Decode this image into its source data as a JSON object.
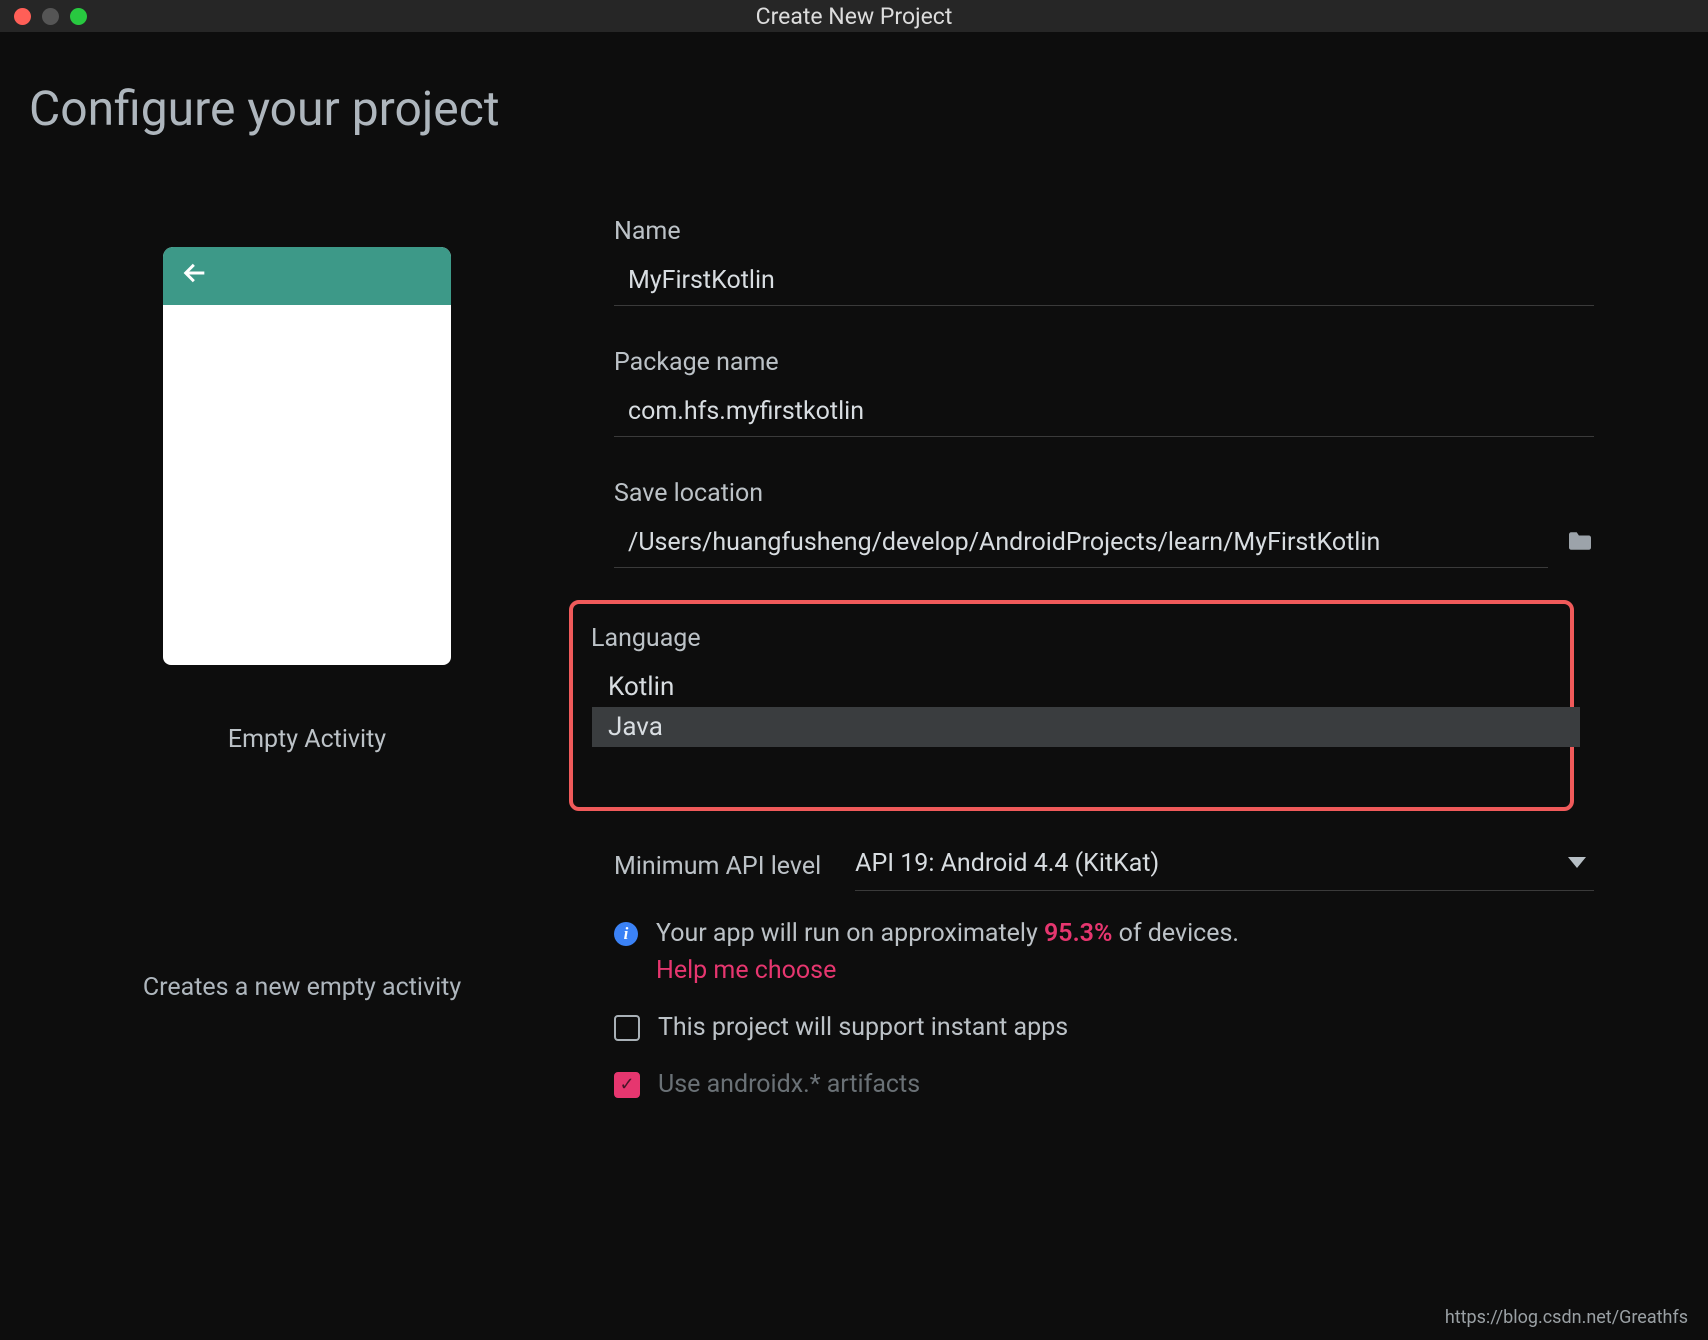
{
  "window": {
    "title": "Create New Project"
  },
  "page": {
    "heading": "Configure your project"
  },
  "preview": {
    "template_name": "Empty Activity",
    "description": "Creates a new empty activity"
  },
  "form": {
    "name": {
      "label": "Name",
      "value": "MyFirstKotlin"
    },
    "package": {
      "label": "Package name",
      "value": "com.hfs.myfirstkotlin"
    },
    "save_location": {
      "label": "Save location",
      "value": "/Users/huangfusheng/develop/AndroidProjects/learn/MyFirstKotlin"
    },
    "language": {
      "label": "Language",
      "options": [
        "Kotlin",
        "Java"
      ],
      "selected": "Java"
    },
    "api": {
      "label": "Minimum API level",
      "value": "API 19: Android 4.4 (KitKat)"
    },
    "info": {
      "prefix": "Your app will run on approximately ",
      "percent": "95.3%",
      "suffix": " of devices.",
      "help": "Help me choose"
    },
    "instant_apps": {
      "label": "This project will support instant apps",
      "checked": false
    },
    "androidx": {
      "label": "Use androidx.* artifacts",
      "checked": true
    }
  },
  "watermark": "https://blog.csdn.net/Greathfs"
}
